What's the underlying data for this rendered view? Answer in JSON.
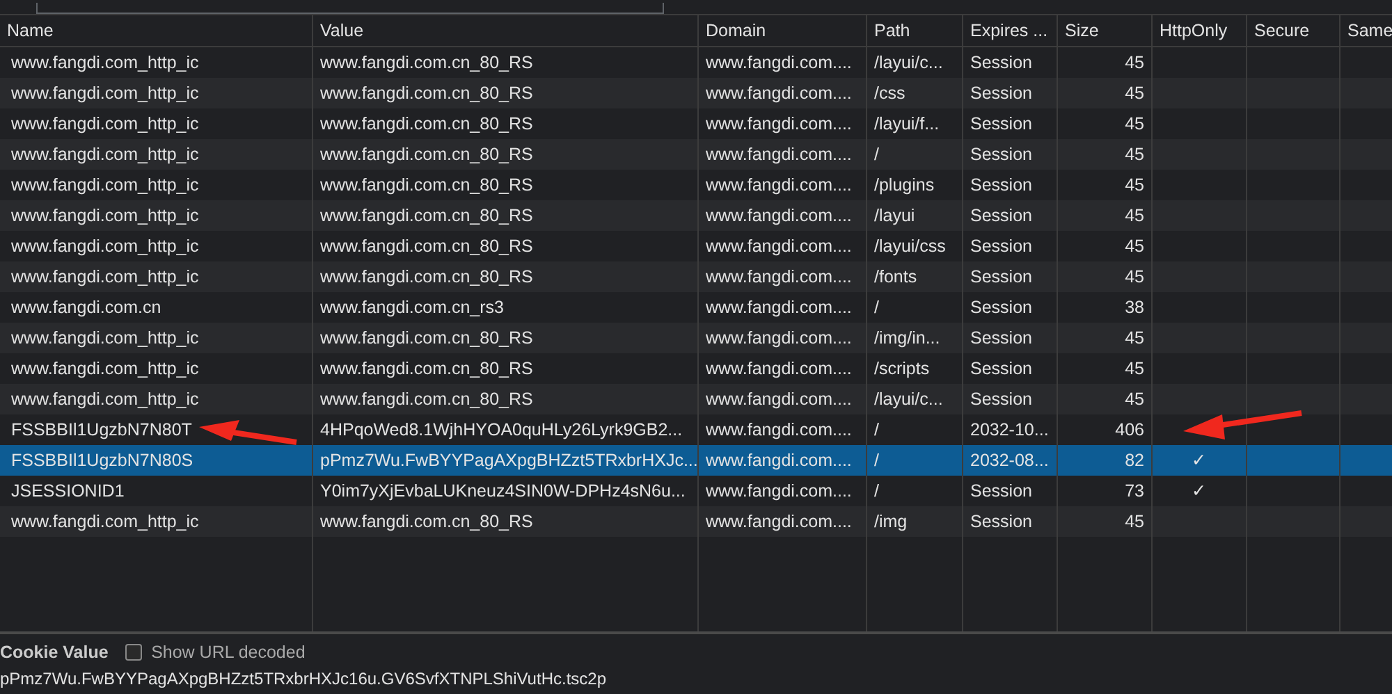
{
  "table": {
    "columns": [
      "Name",
      "Value",
      "Domain",
      "Path",
      "Expires ...",
      "Size",
      "HttpOnly",
      "Secure",
      "Same"
    ],
    "rows": [
      {
        "name": "www.fangdi.com_http_ic",
        "value": "www.fangdi.com.cn_80_RS",
        "domain": "www.fangdi.com....",
        "path": "/layui/c...",
        "expires": "Session",
        "size": "45",
        "http_only": false,
        "selected": false
      },
      {
        "name": "www.fangdi.com_http_ic",
        "value": "www.fangdi.com.cn_80_RS",
        "domain": "www.fangdi.com....",
        "path": "/css",
        "expires": "Session",
        "size": "45",
        "http_only": false,
        "selected": false
      },
      {
        "name": "www.fangdi.com_http_ic",
        "value": "www.fangdi.com.cn_80_RS",
        "domain": "www.fangdi.com....",
        "path": "/layui/f...",
        "expires": "Session",
        "size": "45",
        "http_only": false,
        "selected": false
      },
      {
        "name": "www.fangdi.com_http_ic",
        "value": "www.fangdi.com.cn_80_RS",
        "domain": "www.fangdi.com....",
        "path": "/",
        "expires": "Session",
        "size": "45",
        "http_only": false,
        "selected": false
      },
      {
        "name": "www.fangdi.com_http_ic",
        "value": "www.fangdi.com.cn_80_RS",
        "domain": "www.fangdi.com....",
        "path": "/plugins",
        "expires": "Session",
        "size": "45",
        "http_only": false,
        "selected": false
      },
      {
        "name": "www.fangdi.com_http_ic",
        "value": "www.fangdi.com.cn_80_RS",
        "domain": "www.fangdi.com....",
        "path": "/layui",
        "expires": "Session",
        "size": "45",
        "http_only": false,
        "selected": false
      },
      {
        "name": "www.fangdi.com_http_ic",
        "value": "www.fangdi.com.cn_80_RS",
        "domain": "www.fangdi.com....",
        "path": "/layui/css",
        "expires": "Session",
        "size": "45",
        "http_only": false,
        "selected": false
      },
      {
        "name": "www.fangdi.com_http_ic",
        "value": "www.fangdi.com.cn_80_RS",
        "domain": "www.fangdi.com....",
        "path": "/fonts",
        "expires": "Session",
        "size": "45",
        "http_only": false,
        "selected": false
      },
      {
        "name": "www.fangdi.com.cn",
        "value": "www.fangdi.com.cn_rs3",
        "domain": "www.fangdi.com....",
        "path": "/",
        "expires": "Session",
        "size": "38",
        "http_only": false,
        "selected": false
      },
      {
        "name": "www.fangdi.com_http_ic",
        "value": "www.fangdi.com.cn_80_RS",
        "domain": "www.fangdi.com....",
        "path": "/img/in...",
        "expires": "Session",
        "size": "45",
        "http_only": false,
        "selected": false
      },
      {
        "name": "www.fangdi.com_http_ic",
        "value": "www.fangdi.com.cn_80_RS",
        "domain": "www.fangdi.com....",
        "path": "/scripts",
        "expires": "Session",
        "size": "45",
        "http_only": false,
        "selected": false
      },
      {
        "name": "www.fangdi.com_http_ic",
        "value": "www.fangdi.com.cn_80_RS",
        "domain": "www.fangdi.com....",
        "path": "/layui/c...",
        "expires": "Session",
        "size": "45",
        "http_only": false,
        "selected": false
      },
      {
        "name": "FSSBBIl1UgzbN7N80T",
        "value": "4HPqoWed8.1WjhHYOA0quHLy26Lyrk9GB2...",
        "domain": "www.fangdi.com....",
        "path": "/",
        "expires": "2032-10...",
        "size": "406",
        "http_only": false,
        "selected": false
      },
      {
        "name": "FSSBBIl1UgzbN7N80S",
        "value": "pPmz7Wu.FwBYYPagAXpgBHZzt5TRxbrHXJc...",
        "domain": "www.fangdi.com....",
        "path": "/",
        "expires": "2032-08...",
        "size": "82",
        "http_only": true,
        "selected": true
      },
      {
        "name": "JSESSIONID1",
        "value": "Y0im7yXjEvbaLUKneuz4SIN0W-DPHz4sN6u...",
        "domain": "www.fangdi.com....",
        "path": "/",
        "expires": "Session",
        "size": "73",
        "http_only": true,
        "selected": false
      },
      {
        "name": "www.fangdi.com_http_ic",
        "value": "www.fangdi.com.cn_80_RS",
        "domain": "www.fangdi.com....",
        "path": "/img",
        "expires": "Session",
        "size": "45",
        "http_only": false,
        "selected": false
      }
    ],
    "check_mark": "✓"
  },
  "cookie_value": {
    "title": "Cookie Value",
    "show_url_decoded": {
      "label": "Show URL decoded",
      "checked": false
    },
    "value": "pPmz7Wu.FwBYYPagAXpgBHZzt5TRxbrHXJc16u.GV6SvfXTNPLShiVutHc.tsc2p"
  }
}
